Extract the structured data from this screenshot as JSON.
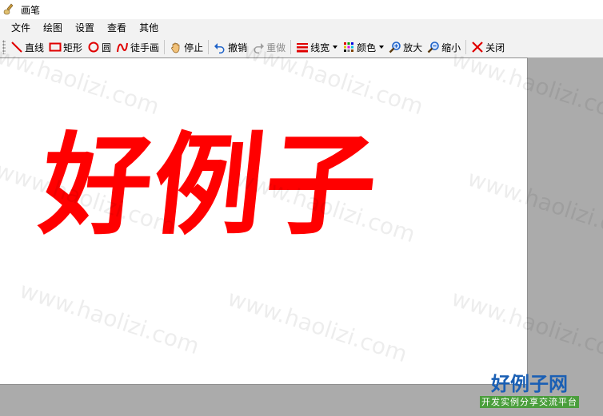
{
  "window": {
    "title": "画笔"
  },
  "menu": [
    "文件",
    "绘图",
    "设置",
    "查看",
    "其他"
  ],
  "toolbar": {
    "line": "直线",
    "rect": "矩形",
    "circle": "圆",
    "freehand": "徒手画",
    "stop": "停止",
    "undo": "撤销",
    "redo": "重做",
    "line_width": "线宽",
    "color": "颜色",
    "zoom_in": "放大",
    "zoom_out": "缩小",
    "close": "关闭"
  },
  "canvas": {
    "drawing_text": "好例子",
    "stroke_color": "#ff0000"
  },
  "watermark": "www.haolizi.com",
  "logo": {
    "title": "好例子网",
    "subtitle": "开发实例分享交流平台"
  },
  "icons": [
    "brush-icon",
    "line-icon",
    "rect-icon",
    "circle-icon",
    "freehand-icon",
    "hand-icon",
    "undo-icon",
    "redo-icon",
    "line-width-icon",
    "color-icon",
    "zoom-in-icon",
    "zoom-out-icon",
    "close-icon"
  ]
}
